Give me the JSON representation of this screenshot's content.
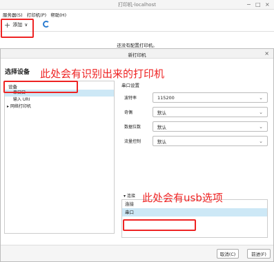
{
  "bg_window": {
    "title": "打印机-localhost",
    "menu": [
      "服务器(S)",
      "打印机(P)",
      "帮助(H)"
    ],
    "toolbar": {
      "add_label": "添加",
      "add_dropdown": "∨"
    },
    "message": "还没有配置打印机。"
  },
  "dialog": {
    "title": "新打印机",
    "heading": "选择设备",
    "left_panel": {
      "label": "设备",
      "items": [
        "串口口",
        "输入 URI",
        "网络打印机"
      ]
    },
    "serial_settings": {
      "label": "串口设置",
      "rows": [
        {
          "label": "波特率",
          "value": "115200"
        },
        {
          "label": "奇偶",
          "value": "默认"
        },
        {
          "label": "数据位数",
          "value": "默认"
        },
        {
          "label": "流量控制",
          "value": "默认"
        }
      ]
    },
    "connection": {
      "label": "连接",
      "items": [
        "连接",
        "串口"
      ]
    },
    "buttons": {
      "cancel": "取消(C)",
      "forward": "前进(F)"
    }
  },
  "annotations": {
    "top": "此处会有识别出来的打印机",
    "bottom": "此处会有usb选项"
  },
  "colors": {
    "annotation": "#e22222",
    "selection": "#cde8f6",
    "accent": "#2a7bd0"
  }
}
